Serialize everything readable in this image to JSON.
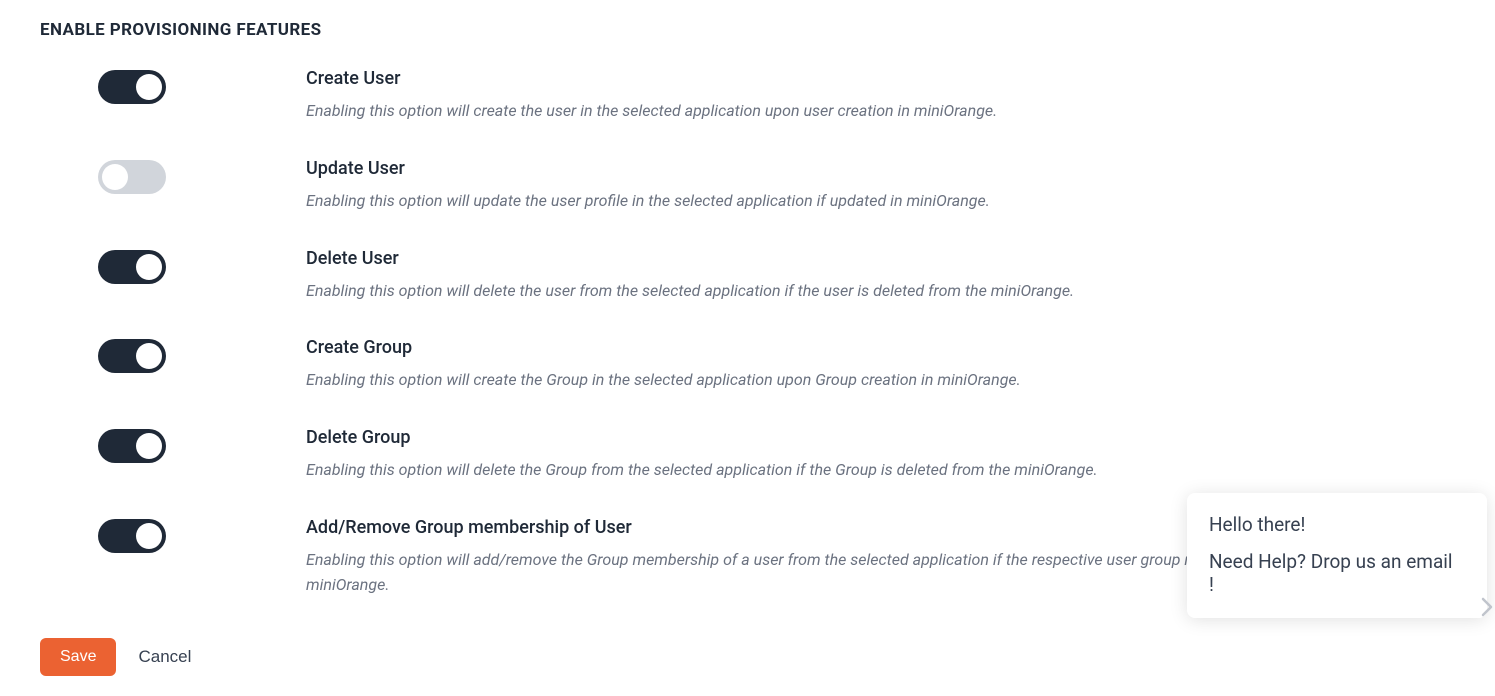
{
  "section_heading": "ENABLE PROVISIONING FEATURES",
  "features": [
    {
      "title": "Create User",
      "description": "Enabling this option will create the user in the selected application upon user creation in miniOrange.",
      "enabled": true
    },
    {
      "title": "Update User",
      "description": "Enabling this option will update the user profile in the selected application if updated in miniOrange.",
      "enabled": false
    },
    {
      "title": "Delete User",
      "description": "Enabling this option will delete the user from the selected application if the user is deleted from the miniOrange.",
      "enabled": true
    },
    {
      "title": "Create Group",
      "description": "Enabling this option will create the Group in the selected application upon Group creation in miniOrange.",
      "enabled": true
    },
    {
      "title": "Delete Group",
      "description": "Enabling this option will delete the Group from the selected application if the Group is deleted from the miniOrange.",
      "enabled": true
    },
    {
      "title": "Add/Remove Group membership of User",
      "description": "Enabling this option will add/remove the Group membership of a user from the selected application if the respective user group membership is updated from the miniOrange.",
      "enabled": true
    }
  ],
  "buttons": {
    "save": "Save",
    "cancel": "Cancel"
  },
  "help_widget": {
    "greeting": "Hello there!",
    "prompt": "Need Help? Drop us an email !"
  }
}
